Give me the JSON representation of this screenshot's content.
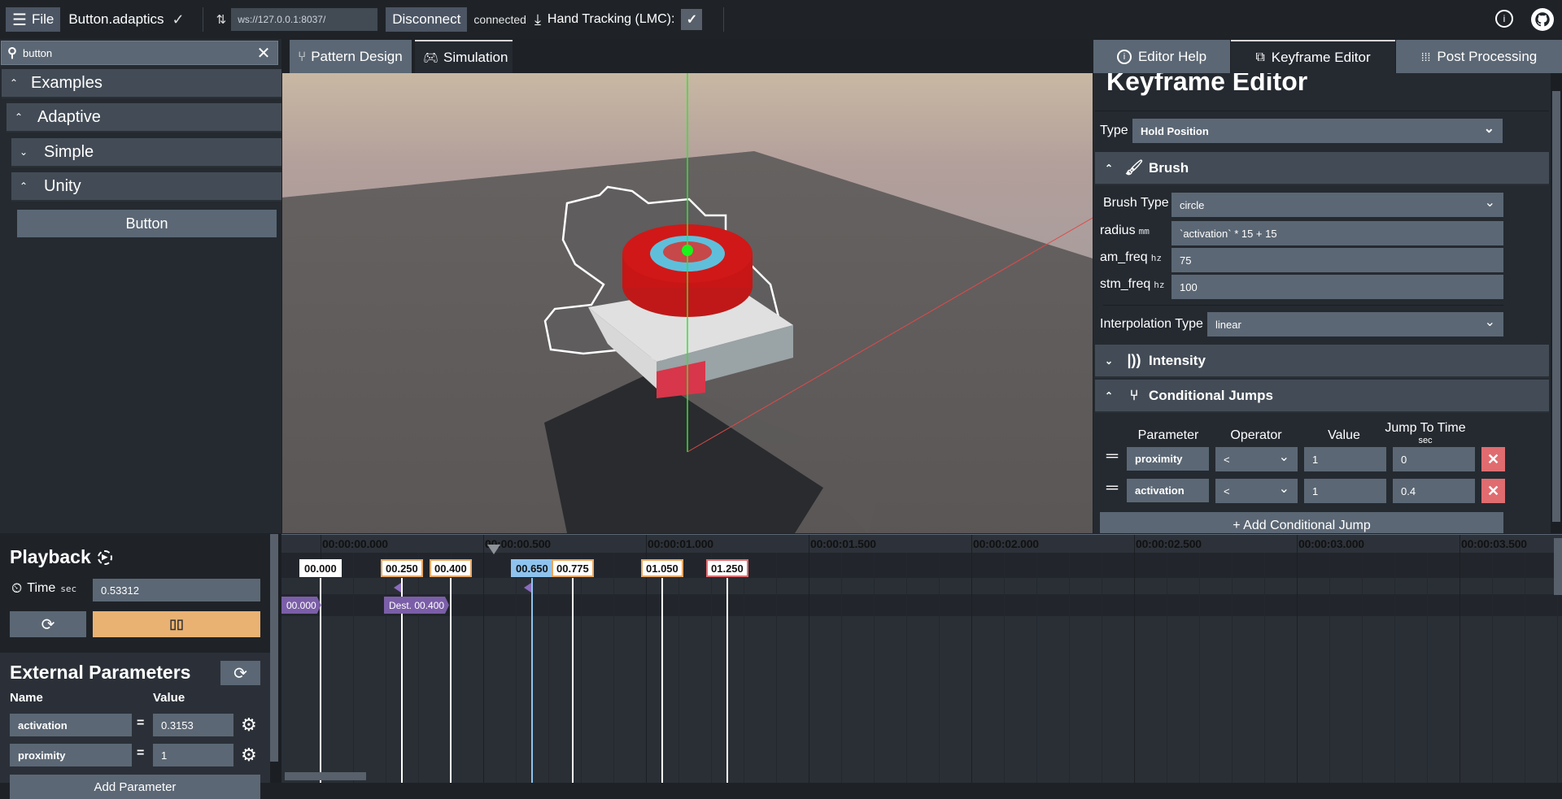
{
  "topbar": {
    "file_label": "File",
    "filename": "Button.adaptics",
    "saved_icon": "checkmark-icon",
    "sort_icon": "swap-vertical-icon",
    "ws_url": "ws://127.0.0.1:8037/",
    "disconnect_label": "Disconnect",
    "status": "connected",
    "hand_tracking_label": "Hand Tracking (LMC):",
    "hand_tracking_checked": true,
    "right_icons": [
      "accessibility-icon",
      "github-icon"
    ]
  },
  "sidebar": {
    "search_value": "button",
    "tree": [
      {
        "label": "Examples",
        "expanded": true,
        "level": 0
      },
      {
        "label": "Adaptive",
        "expanded": true,
        "level": 1
      },
      {
        "label": "Simple",
        "expanded": false,
        "level": 2
      },
      {
        "label": "Unity",
        "expanded": true,
        "level": 2
      }
    ],
    "leaf": "Button"
  },
  "center_tabs": [
    {
      "label": "Pattern Design",
      "icon": "pattern-design-icon",
      "active": false
    },
    {
      "label": "Simulation",
      "icon": "gamepad-icon",
      "active": true
    }
  ],
  "right_tabs": [
    {
      "label": "Editor Help",
      "icon": "info-icon",
      "active": false
    },
    {
      "label": "Keyframe Editor",
      "icon": "keyframe-stack-icon",
      "active": true
    },
    {
      "label": "Post Processing",
      "icon": "dot-grid-icon",
      "active": false
    }
  ],
  "keyframe_editor": {
    "title": "Keyframe Editor",
    "type_label": "Type",
    "type_value": "Hold Position",
    "brush": {
      "title": "Brush",
      "brush_type_label": "Brush Type",
      "brush_type_value": "circle",
      "radius_label": "radius",
      "radius_unit": "mm",
      "radius_value": "`activation` * 15 + 15",
      "am_freq_label": "am_freq",
      "am_freq_unit": "hz",
      "am_freq_value": "75",
      "stm_freq_label": "stm_freq",
      "stm_freq_unit": "hz",
      "stm_freq_value": "100"
    },
    "interp_label": "Interpolation Type",
    "interp_value": "linear",
    "intensity_title": "Intensity",
    "cond_jumps": {
      "title": "Conditional Jumps",
      "headers": [
        "Parameter",
        "Operator",
        "Value",
        "Jump To Time"
      ],
      "jump_unit": "sec",
      "rows": [
        {
          "parameter": "proximity",
          "operator": "<",
          "value": "1",
          "jump_to": "0"
        },
        {
          "parameter": "activation",
          "operator": "<",
          "value": "1",
          "jump_to": "0.4"
        }
      ],
      "add_label": "+ Add Conditional Jump"
    }
  },
  "playback": {
    "title": "Playback",
    "time_label": "Time",
    "time_unit": "sec",
    "time_value": "0.53312",
    "restart_icon": "restart-icon",
    "pause_icon": "pause-icon",
    "playing_color": "#e9b272"
  },
  "external_params": {
    "title": "External Parameters",
    "name_header": "Name",
    "value_header": "Value",
    "params": [
      {
        "name": "activation",
        "value": "0.3153"
      },
      {
        "name": "proximity",
        "value": "1"
      }
    ],
    "add_label": "Add Parameter"
  },
  "timeline": {
    "ticks": [
      "00:00:00.000",
      "00:00:00.500",
      "00:00:01.000",
      "00:00:01.500",
      "00:00:02.000",
      "00:00:02.500",
      "00:00:03.000",
      "00:00:03.500"
    ],
    "playhead_time": 0.53312,
    "keyframes": [
      {
        "label": "00.000",
        "time": 0.0,
        "style": "plain"
      },
      {
        "label": "00.250",
        "time": 0.25,
        "style": "orange"
      },
      {
        "label": "00.400",
        "time": 0.4,
        "style": "orange"
      },
      {
        "label": "00.650",
        "time": 0.65,
        "style": "selected"
      },
      {
        "label": "00.775",
        "time": 0.775,
        "style": "orange"
      },
      {
        "label": "01.050",
        "time": 1.05,
        "style": "orange"
      },
      {
        "label": "01.250",
        "time": 1.25,
        "style": "red"
      }
    ],
    "jump_tags": [
      {
        "label": "00.000",
        "time": 0.0
      },
      {
        "label": "Dest. 00.400",
        "time": 0.4
      }
    ],
    "jump_sources": [
      0.25,
      0.65
    ]
  }
}
